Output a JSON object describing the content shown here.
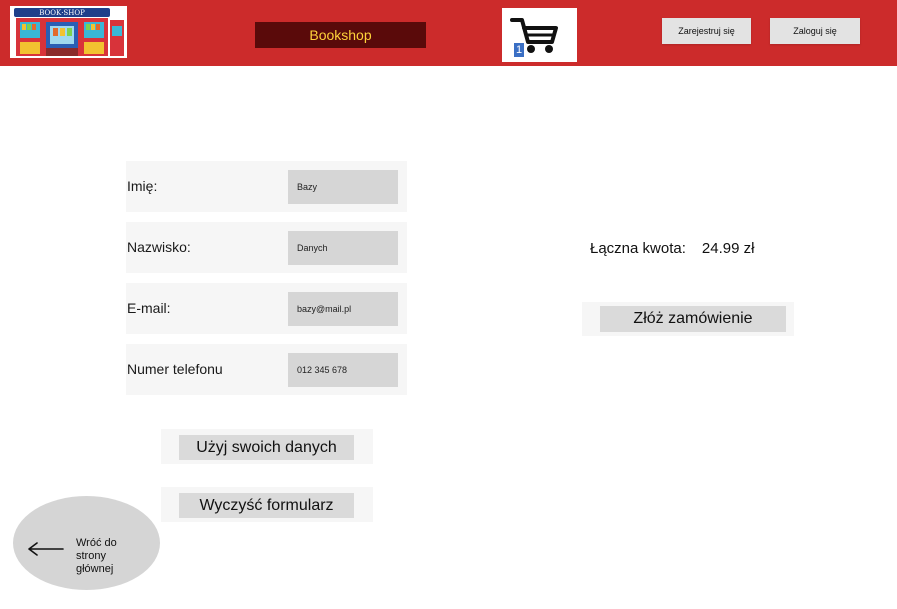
{
  "header": {
    "logo_text": "BOOK·SHOP",
    "brand": "Bookshop",
    "cart_count": "1",
    "register_label": "Zarejestruj się",
    "login_label": "Zaloguj się"
  },
  "form": {
    "fields": [
      {
        "label": "Imię:",
        "value": "Bazy"
      },
      {
        "label": "Nazwisko:",
        "value": "Danych"
      },
      {
        "label": "E-mail:",
        "value": "bazy@mail.pl"
      },
      {
        "label": "Numer telefonu",
        "value": "012 345 678"
      }
    ],
    "use_data_label": "Użyj swoich danych",
    "clear_label": "Wyczyść formularz"
  },
  "summary": {
    "total_label": "Łączna kwota:",
    "total_value": "24.99 zł",
    "order_label": "Złóż zamówienie"
  },
  "back": {
    "line1": "Wróć do",
    "line2": "strony",
    "line3": "głównej"
  },
  "colors": {
    "header": "#cc2b2b",
    "brand_bg": "#5a0a0a",
    "brand_text": "#ffd23a",
    "cart_badge": "#3a6fc4"
  }
}
